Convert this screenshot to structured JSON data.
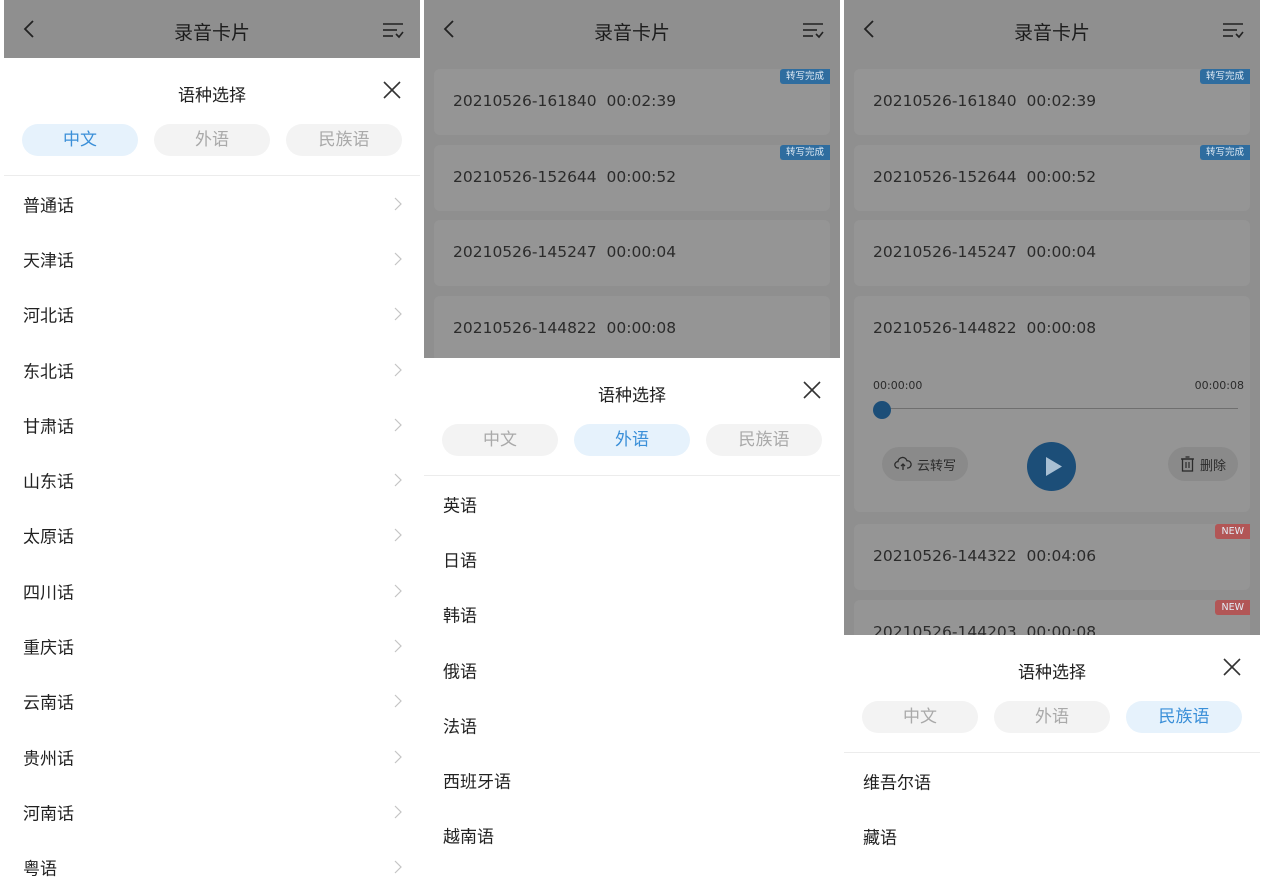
{
  "header": {
    "title": "录音卡片"
  },
  "sheet": {
    "title": "语种选择",
    "tabs": [
      "中文",
      "外语",
      "民族语"
    ]
  },
  "panel1": {
    "active_tab": 0,
    "languages": [
      "普通话",
      "天津话",
      "河北话",
      "东北话",
      "甘肃话",
      "山东话",
      "太原话",
      "四川话",
      "重庆话",
      "云南话",
      "贵州话",
      "河南话",
      "粤语"
    ]
  },
  "panel2": {
    "active_tab": 1,
    "recordings": [
      {
        "label": "20210526-161840  00:02:39",
        "badge": "转写完成"
      },
      {
        "label": "20210526-152644  00:00:52",
        "badge": "转写完成"
      },
      {
        "label": "20210526-145247  00:00:04",
        "badge": ""
      },
      {
        "label": "20210526-144822  00:00:08",
        "badge": ""
      }
    ],
    "languages": [
      "英语",
      "日语",
      "韩语",
      "俄语",
      "法语",
      "西班牙语",
      "越南语"
    ]
  },
  "panel3": {
    "active_tab": 2,
    "recordings": [
      {
        "label": "20210526-161840  00:02:39",
        "badge": "转写完成"
      },
      {
        "label": "20210526-152644  00:00:52",
        "badge": "转写完成"
      },
      {
        "label": "20210526-145247  00:00:04",
        "badge": ""
      },
      {
        "label": "20210526-144822  00:00:08",
        "badge": ""
      },
      {
        "label": "20210526-144322  00:04:06",
        "badge": "NEW"
      },
      {
        "label": "20210526-144203  00:00:08",
        "badge": "NEW"
      }
    ],
    "player": {
      "time_start": "00:00:00",
      "time_end": "00:00:08",
      "progress": 0,
      "cloud_label": "云转写",
      "delete_label": "删除"
    },
    "languages": [
      "维吾尔语",
      "藏语"
    ]
  },
  "colors": {
    "accent": "#3a8fd8",
    "active_tab_bg": "#e6f2fc",
    "badge_done": "#2f6d9f",
    "badge_new": "#b25656",
    "overlay": "#8f8f8f"
  }
}
